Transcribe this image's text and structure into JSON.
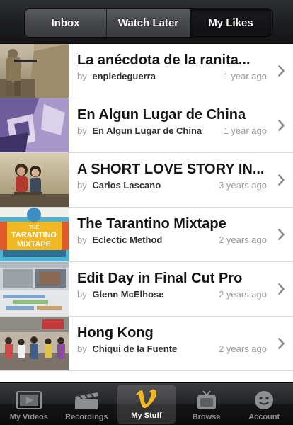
{
  "header": {
    "tabs": [
      {
        "label": "Inbox",
        "selected": false
      },
      {
        "label": "Watch Later",
        "selected": false
      },
      {
        "label": "My Likes",
        "selected": true
      }
    ]
  },
  "videos": [
    {
      "title": "La anécdota de la ranita...",
      "by_label": "by",
      "author": "enpiedeguerra",
      "age": "1 year ago"
    },
    {
      "title": "En Algun Lugar de China",
      "by_label": "by",
      "author": "En Algun Lugar de China",
      "age": "1 year ago"
    },
    {
      "title": "A SHORT LOVE STORY IN...",
      "by_label": "by",
      "author": "Carlos Lascano",
      "age": "3 years ago"
    },
    {
      "title": "The Tarantino Mixtape",
      "by_label": "by",
      "author": "Eclectic Method",
      "age": "2 years ago"
    },
    {
      "title": "Edit Day in Final Cut Pro",
      "by_label": "by",
      "author": "Glenn McElhose",
      "age": "2 years ago"
    },
    {
      "title": "Hong Kong",
      "by_label": "by",
      "author": "Chiqui de la Fuente",
      "age": "2 years ago"
    }
  ],
  "thumbnail_text": {
    "tarantino_line1": "THE",
    "tarantino_line2": "TARANTINO",
    "tarantino_line3": "MIXTAPE"
  },
  "tabbar": {
    "items": [
      {
        "label": "My Videos",
        "icon": "film-icon",
        "selected": false
      },
      {
        "label": "Recordings",
        "icon": "clapperboard-icon",
        "selected": false
      },
      {
        "label": "My Stuff",
        "icon": "vimeo-v-icon",
        "selected": true
      },
      {
        "label": "Browse",
        "icon": "tv-icon",
        "selected": false
      },
      {
        "label": "Account",
        "icon": "smiley-icon",
        "selected": false
      }
    ]
  },
  "colors": {
    "accent_yellow": "#f2b824",
    "text_primary": "#141414",
    "text_secondary": "#9a9a9a"
  }
}
